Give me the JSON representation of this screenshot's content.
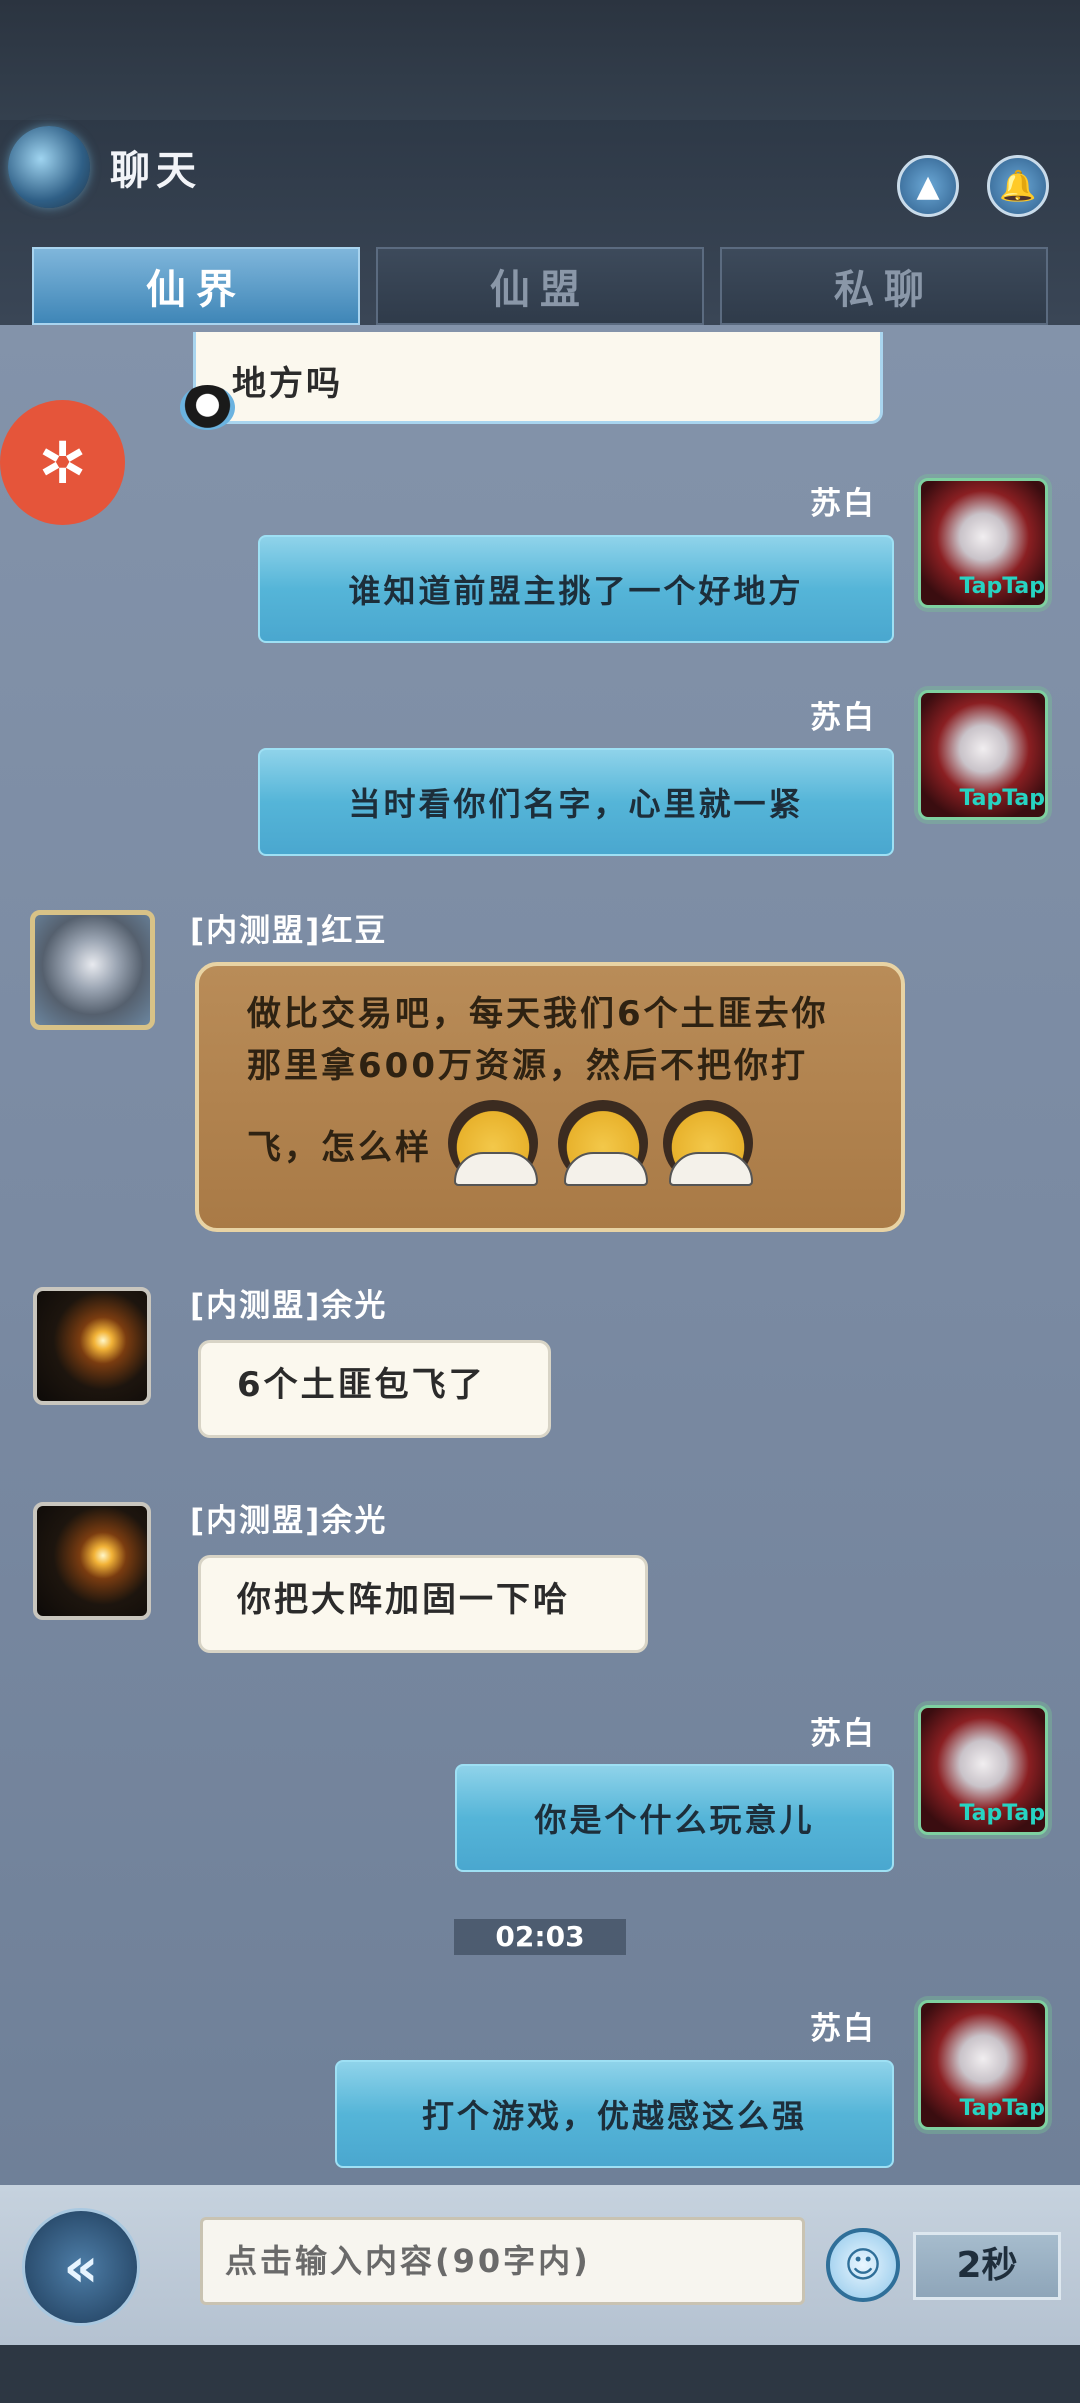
{
  "header": {
    "title": "聊天",
    "tabs": [
      {
        "label": "仙界",
        "active": true
      },
      {
        "label": "仙盟",
        "active": false
      },
      {
        "label": "私聊",
        "active": false
      }
    ]
  },
  "messages": [
    {
      "type": "white",
      "text": "地方吗"
    },
    {
      "sender": "苏白",
      "text": "谁知道前盟主挑了一个好地方"
    },
    {
      "sender": "苏白",
      "text": "当时看你们名字，心里就一紧"
    },
    {
      "sender": "[内测盟]红豆",
      "lines": [
        "做比交易吧，每天我们6个土匪去你",
        "那里拿600万资源，然后不把你打",
        "飞，怎么样"
      ]
    },
    {
      "sender": "[内测盟]余光",
      "text": "6个土匪包飞了"
    },
    {
      "sender": "[内测盟]余光",
      "text": "你把大阵加固一下哈"
    },
    {
      "sender": "苏白",
      "text": "你是个什么玩意儿"
    },
    {
      "sender": "苏白",
      "text": "打个游戏，优越感这么强"
    }
  ],
  "timestamp": "02:03",
  "avatar_badge": "TapTap",
  "input": {
    "placeholder": "点击输入内容(90字内)"
  },
  "cooldown": "2秒",
  "colors": {
    "accent_blue": "#55b5d8",
    "bubble_white": "#fbf8ee",
    "bubble_brown": "#a97a46",
    "floating_button": "#e5553a"
  }
}
